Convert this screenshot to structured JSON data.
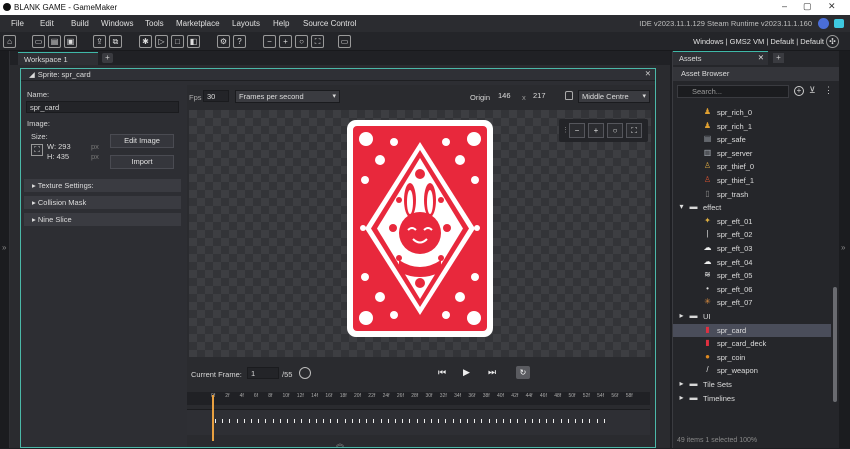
{
  "window": {
    "title": "BLANK GAME - GameMaker",
    "controls": [
      "–",
      "▢",
      "✕"
    ]
  },
  "menu": {
    "items": [
      "File",
      "Edit",
      "Build",
      "Windows",
      "Tools",
      "Marketplace",
      "Layouts",
      "Help",
      "Source Control"
    ],
    "ide_version": "IDE v2023.11.1.129  Steam  Runtime v2023.11.1.160"
  },
  "toolbar": {
    "targets": "Windows | GMS2 VM | Default | Default"
  },
  "workspace": {
    "tab_label": "Workspace 1",
    "add_label": "+"
  },
  "sprite_editor": {
    "header": "Sprite: spr_card",
    "close_label": "✕",
    "name_label": "Name:",
    "name_value": "spr_card",
    "image_label": "Image:",
    "size_label": "Size:",
    "width": "W: 293",
    "height": "H: 435",
    "unit_px": "px",
    "edit_image": "Edit Image",
    "import": "Import",
    "sections": [
      "Texture Settings:",
      "Collision Mask",
      "Nine Slice"
    ],
    "fps_label": "Fps",
    "fps_value": "30",
    "fps_mode": "Frames per second",
    "origin_label": "Origin",
    "origin_x": "146",
    "origin_sep": "x",
    "origin_y": "217",
    "origin_preset": "Middle Centre",
    "current_frame_label": "Current Frame:",
    "current_frame": "1",
    "frame_total": "/55",
    "ruler_ticks": [
      "0f",
      "2f",
      "4f",
      "6f",
      "8f",
      "10f",
      "12f",
      "14f",
      "16f",
      "18f",
      "20f",
      "22f",
      "24f",
      "26f",
      "28f",
      "30f",
      "32f",
      "34f",
      "36f",
      "38f",
      "40f",
      "42f",
      "44f",
      "46f",
      "48f",
      "50f",
      "52f",
      "54f",
      "56f",
      "58f"
    ]
  },
  "assets": {
    "tab_label": "Assets",
    "tab_close": "✕",
    "add_label": "+",
    "browser_title": "Asset Browser",
    "search_placeholder": "Search...",
    "items": [
      {
        "label": "spr_rich_0",
        "icon": "coin-char-icon",
        "color": "#e0a030"
      },
      {
        "label": "spr_rich_1",
        "icon": "coin-char-icon",
        "color": "#e0a030"
      },
      {
        "label": "spr_safe",
        "icon": "safe-icon",
        "color": "#9aa0a8"
      },
      {
        "label": "spr_server",
        "icon": "server-icon",
        "color": "#aab0b8"
      },
      {
        "label": "spr_thief_0",
        "icon": "thief-icon",
        "color": "#d0a040"
      },
      {
        "label": "spr_thief_1",
        "icon": "thief-icon",
        "color": "#d05030"
      },
      {
        "label": "spr_trash",
        "icon": "trash-icon",
        "color": "#888"
      },
      {
        "label": "effect",
        "icon": "folder-icon",
        "color": "#d8d8d8"
      },
      {
        "label": "spr_eft_01",
        "icon": "spark-icon",
        "color": "#e0b040"
      },
      {
        "label": "spr_eft_02",
        "icon": "line-icon",
        "color": "#dddddd"
      },
      {
        "label": "spr_eft_03",
        "icon": "cloud-icon",
        "color": "#eeeeee"
      },
      {
        "label": "spr_eft_04",
        "icon": "cloud-icon",
        "color": "#eeeeee"
      },
      {
        "label": "spr_eft_05",
        "icon": "wind-icon",
        "color": "#eeeeee"
      },
      {
        "label": "spr_eft_06",
        "icon": "dot-icon",
        "color": "#dddddd"
      },
      {
        "label": "spr_eft_07",
        "icon": "burst-icon",
        "color": "#e09040"
      },
      {
        "label": "UI",
        "icon": "folder-icon",
        "color": "#d8d8d8"
      },
      {
        "label": "spr_card",
        "icon": "card-icon",
        "color": "#e03040"
      },
      {
        "label": "spr_card_deck",
        "icon": "card-icon",
        "color": "#e03040"
      },
      {
        "label": "spr_coin",
        "icon": "coin-icon",
        "color": "#e08a20"
      },
      {
        "label": "spr_weapon",
        "icon": "sword-icon",
        "color": "#dddddd"
      },
      {
        "label": "Tile Sets",
        "icon": "folder-icon",
        "color": "#d8d8d8"
      },
      {
        "label": "Timelines",
        "icon": "folder-icon",
        "color": "#d8d8d8"
      }
    ],
    "status": "49 items   1 selected   100%"
  },
  "colors": {
    "accent": "#3fb8a8",
    "card_red": "#e8283c",
    "playhead": "#e8a040"
  }
}
